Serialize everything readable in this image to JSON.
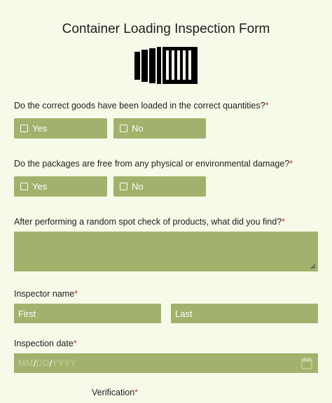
{
  "form": {
    "title": "Container Loading Inspection Form",
    "logo_icon": "shipping-container-icon",
    "accent_color": "#a1b26c",
    "background_color": "#f6fbe9",
    "required_marker": "*",
    "required_color": "#d0312d",
    "q1": {
      "label": "Do the correct goods have been loaded in the correct quantities?",
      "options": [
        "Yes",
        "No"
      ]
    },
    "q2": {
      "label": "Do the packages are free from any physical or environmental damage?",
      "options": [
        "Yes",
        "No"
      ]
    },
    "q3": {
      "label": "After performing a random spot check of products, what did you find?",
      "value": ""
    },
    "inspector": {
      "label": "Inspector name",
      "first_placeholder": "First",
      "last_placeholder": "Last"
    },
    "date": {
      "label": "Inspection date",
      "mm": "MM",
      "dd": "DD",
      "yyyy": "YYYY",
      "sep": "/",
      "icon": "calendar-icon"
    },
    "verification": {
      "label": "Verification"
    }
  }
}
